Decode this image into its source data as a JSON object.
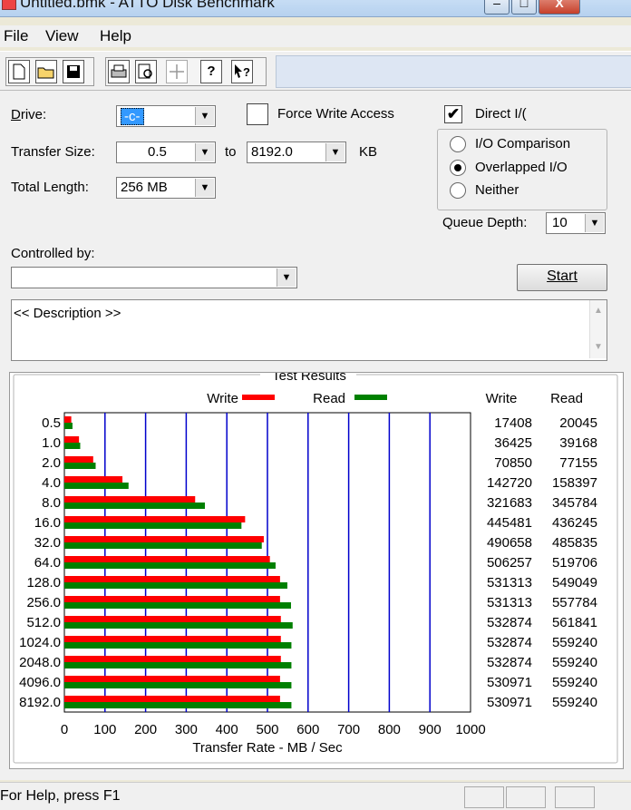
{
  "window": {
    "title": "Untitled.bmk - ATTO Disk Benchmark",
    "controls": [
      "–",
      "□",
      "X"
    ]
  },
  "menu": {
    "items": [
      "File",
      "View",
      "Help"
    ]
  },
  "toolbar": {
    "icons": [
      "new-file-icon",
      "open-folder-icon",
      "save-icon",
      "print-icon",
      "print-preview-icon",
      "move-icon",
      "help-icon",
      "context-help-icon"
    ]
  },
  "form": {
    "drive_label": "Drive:",
    "drive_value": "-c-",
    "force_write_label": "Force Write Access",
    "force_write_checked": false,
    "direct_io_label": "Direct I/(",
    "direct_io_checked": true,
    "transfer_size_label": "Transfer Size:",
    "transfer_from": "0.5",
    "to_label": "to",
    "transfer_to": "8192.0",
    "kb_label": "KB",
    "total_length_label": "Total Length:",
    "total_length_value": "256 MB",
    "radio_options": [
      "I/O Comparison",
      "Overlapped I/O",
      "Neither"
    ],
    "radio_selected": "Overlapped I/O",
    "queue_depth_label": "Queue Depth:",
    "queue_depth_value": "10",
    "controlled_by_label": "Controlled by:",
    "controlled_by_value": "",
    "start_label": "Start",
    "description": "<< Description >>"
  },
  "chart_data": {
    "type": "bar",
    "title": "Test Results",
    "legend": [
      {
        "name": "Write",
        "color": "#ff0000"
      },
      {
        "name": "Read",
        "color": "#008000"
      }
    ],
    "categories": [
      "0.5",
      "1.0",
      "2.0",
      "4.0",
      "8.0",
      "16.0",
      "32.0",
      "64.0",
      "128.0",
      "256.0",
      "512.0",
      "1024.0",
      "2048.0",
      "4096.0",
      "8192.0"
    ],
    "series": [
      {
        "name": "Write",
        "color": "#ff0000",
        "values": [
          17,
          36,
          71,
          143,
          322,
          445,
          491,
          506,
          531,
          531,
          533,
          533,
          533,
          531,
          531
        ]
      },
      {
        "name": "Read",
        "color": "#008000",
        "values": [
          20,
          39,
          77,
          158,
          346,
          436,
          486,
          520,
          549,
          558,
          562,
          559,
          559,
          559,
          559
        ]
      }
    ],
    "table_headers": [
      "Write",
      "Read"
    ],
    "write_values": [
      "17408",
      "36425",
      "70850",
      "142720",
      "321683",
      "445481",
      "490658",
      "506257",
      "531313",
      "531313",
      "532874",
      "532874",
      "532874",
      "530971",
      "530971"
    ],
    "read_values": [
      "20045",
      "39168",
      "77155",
      "158397",
      "345784",
      "436245",
      "485835",
      "519706",
      "549049",
      "557784",
      "561841",
      "559240",
      "559240",
      "559240",
      "559240"
    ],
    "x_ticks": [
      "0",
      "100",
      "200",
      "300",
      "400",
      "500",
      "600",
      "700",
      "800",
      "900",
      "1000"
    ],
    "xlim": [
      0,
      1000
    ],
    "xlabel": "Transfer Rate - MB / Sec",
    "grid": true,
    "grid_color": "#0000cc"
  },
  "status": {
    "text": "For Help, press F1"
  }
}
